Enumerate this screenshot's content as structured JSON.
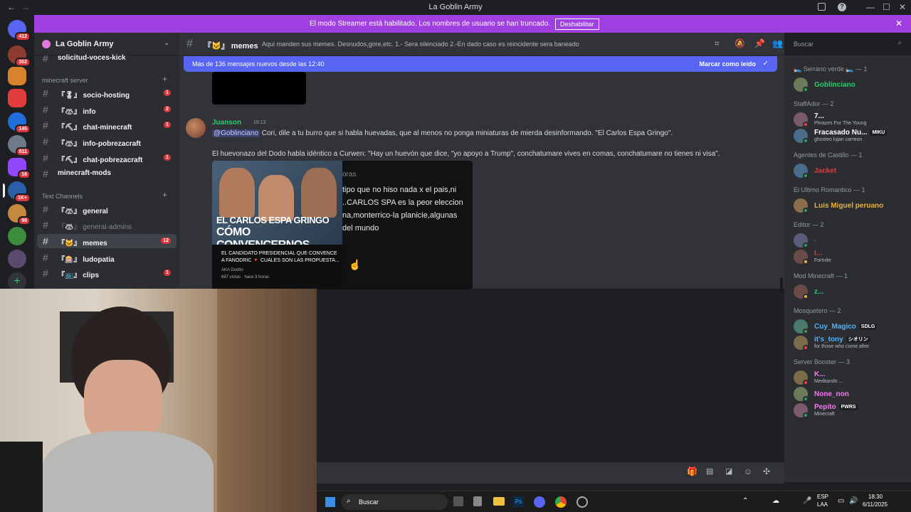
{
  "window": {
    "title": "La Goblin Army",
    "minimize": "—",
    "maximize": "☐",
    "close": "✕"
  },
  "banner": {
    "text": "El modo Streamer está habilitado. Los nombres de usuario se han truncado.",
    "button": "Deshabilitar"
  },
  "rail": {
    "badges": [
      "412",
      "302",
      "145",
      "811",
      "16",
      "1K+",
      "98"
    ]
  },
  "guild": {
    "name": "La Goblin Army"
  },
  "sidebar": {
    "top_channel": "solicitud-voces-kick",
    "cat_minecraft": "minecraft server",
    "cat_text": "Text Channels",
    "channels_mc": [
      {
        "name": "『🎖』 socio-hosting",
        "badge": "1"
      },
      {
        "name": "『🦝』 info",
        "badge": "2"
      },
      {
        "name": "『⛏』 chat-minecraft",
        "badge": "1"
      },
      {
        "name": "『🦝』 info-pobrezacraft",
        "badge": ""
      },
      {
        "name": "『⛏』 chat-pobrezacraft",
        "badge": "1"
      },
      {
        "name": "minecraft-mods",
        "badge": ""
      }
    ],
    "channels_text": [
      {
        "name": "『🦝』 general",
        "badge": ""
      },
      {
        "name": "『🦝』 general-admins",
        "badge": ""
      },
      {
        "name": "『🐱』 memes",
        "badge": "12"
      },
      {
        "name": "『🎰』 ludopatia",
        "badge": ""
      },
      {
        "name": "『📺』 clips",
        "badge": "1"
      }
    ]
  },
  "header": {
    "channel": "『🐱』 memes",
    "topic": "Aqui manden sus memes. Desnudos,gore,etc. 1.- Sera silenciado 2.-En dado caso es reincidente sera baneado",
    "search_placeholder": "Buscar"
  },
  "chat": {
    "new_messages": "Más de 136 mensajes nuevos desde las 12:40",
    "mark_read": "Marcar como leído",
    "message": {
      "author": "Juanson",
      "time": "18:13",
      "mention": "@Goblinciano",
      "line1": " Cori, dile a tu burro que si habla huevadas, que al menos no ponga miniaturas de mierda desinformando. \"El Carlos Espa Gringo\".",
      "line2": "El huevonazo del Dodo habla idéntico a Curwen: \"Hay un huevón que dice, \"yo apoyo a Trump\", conchatumare vives en comas, conchatumare no tienes ni visa\"."
    },
    "embed": {
      "thumb_title_1": "EL CARLOS ESPA GRINGO",
      "thumb_title_2": "CÓMO CONVENCERNOS",
      "video_title_1": "EL CANDIDATO PRESIDENCIAL QUE CONVENCE",
      "video_title_2": "A FANODRIC 🔻 CUALES SON LAS PROPUESTA...",
      "channel": "AKA Dodito",
      "views": "687 vistas · hace 3 horas",
      "tweet_lines": [
        "oras",
        "tipo que no hiso nada x el pais,ni",
        "..CARLOS SPA es la peor eleccion",
        "na,monterrico-la planicie,algunas",
        "del mundo"
      ]
    }
  },
  "members": {
    "groups": [
      {
        "title": "🛌 Serrano verde 🛌 — 1",
        "members": [
          {
            "name": "Goblinciano",
            "color": "#2dc770",
            "status": ""
          }
        ]
      },
      {
        "title": "StaffAdor — 2",
        "members": [
          {
            "name": "7...",
            "color": "#ffffff",
            "status": "Phrazes For The Young"
          },
          {
            "name": "Fracasado Nu...",
            "color": "#ffffff",
            "status": "ghosteo lujan carreon",
            "tag": "MIKU"
          }
        ]
      },
      {
        "title": "Agentes de Castillo — 1",
        "members": [
          {
            "name": "Jacket",
            "color": "#e03b3b",
            "status": ""
          }
        ]
      },
      {
        "title": "El Ultimo Romantico — 1",
        "members": [
          {
            "name": "Luis Miguel peruano",
            "color": "#e8b13f",
            "status": ""
          }
        ]
      },
      {
        "title": "Editor — 2",
        "members": [
          {
            "name": "·",
            "color": "#e03b3b",
            "status": ""
          },
          {
            "name": "I...",
            "color": "#e03b3b",
            "status": "Fortnite"
          }
        ]
      },
      {
        "title": "Mod Minecraft — 1",
        "members": [
          {
            "name": "z...",
            "color": "#2dc770",
            "status": ""
          }
        ]
      },
      {
        "title": "Mosquetero — 2",
        "members": [
          {
            "name": "Cuy_Magico",
            "color": "#4fb3ff",
            "status": "",
            "tag": "SDLG"
          },
          {
            "name": "it's_tony",
            "color": "#4fb3ff",
            "status": "for those who come after",
            "tag": "シオリン"
          }
        ]
      },
      {
        "title": "Server Booster — 3",
        "members": [
          {
            "name": "K...",
            "color": "#ff73fa",
            "status": "Meditando ..."
          },
          {
            "name": "None_non",
            "color": "#ff73fa",
            "status": ""
          },
          {
            "name": "Pepito",
            "color": "#ff73fa",
            "status": "Minecraft",
            "tag": "PWRS"
          }
        ]
      }
    ]
  },
  "taskbar": {
    "search": "Buscar",
    "lang": "ESP",
    "lang2": "LAA",
    "time": "18:30",
    "date": "6/11/2025"
  }
}
